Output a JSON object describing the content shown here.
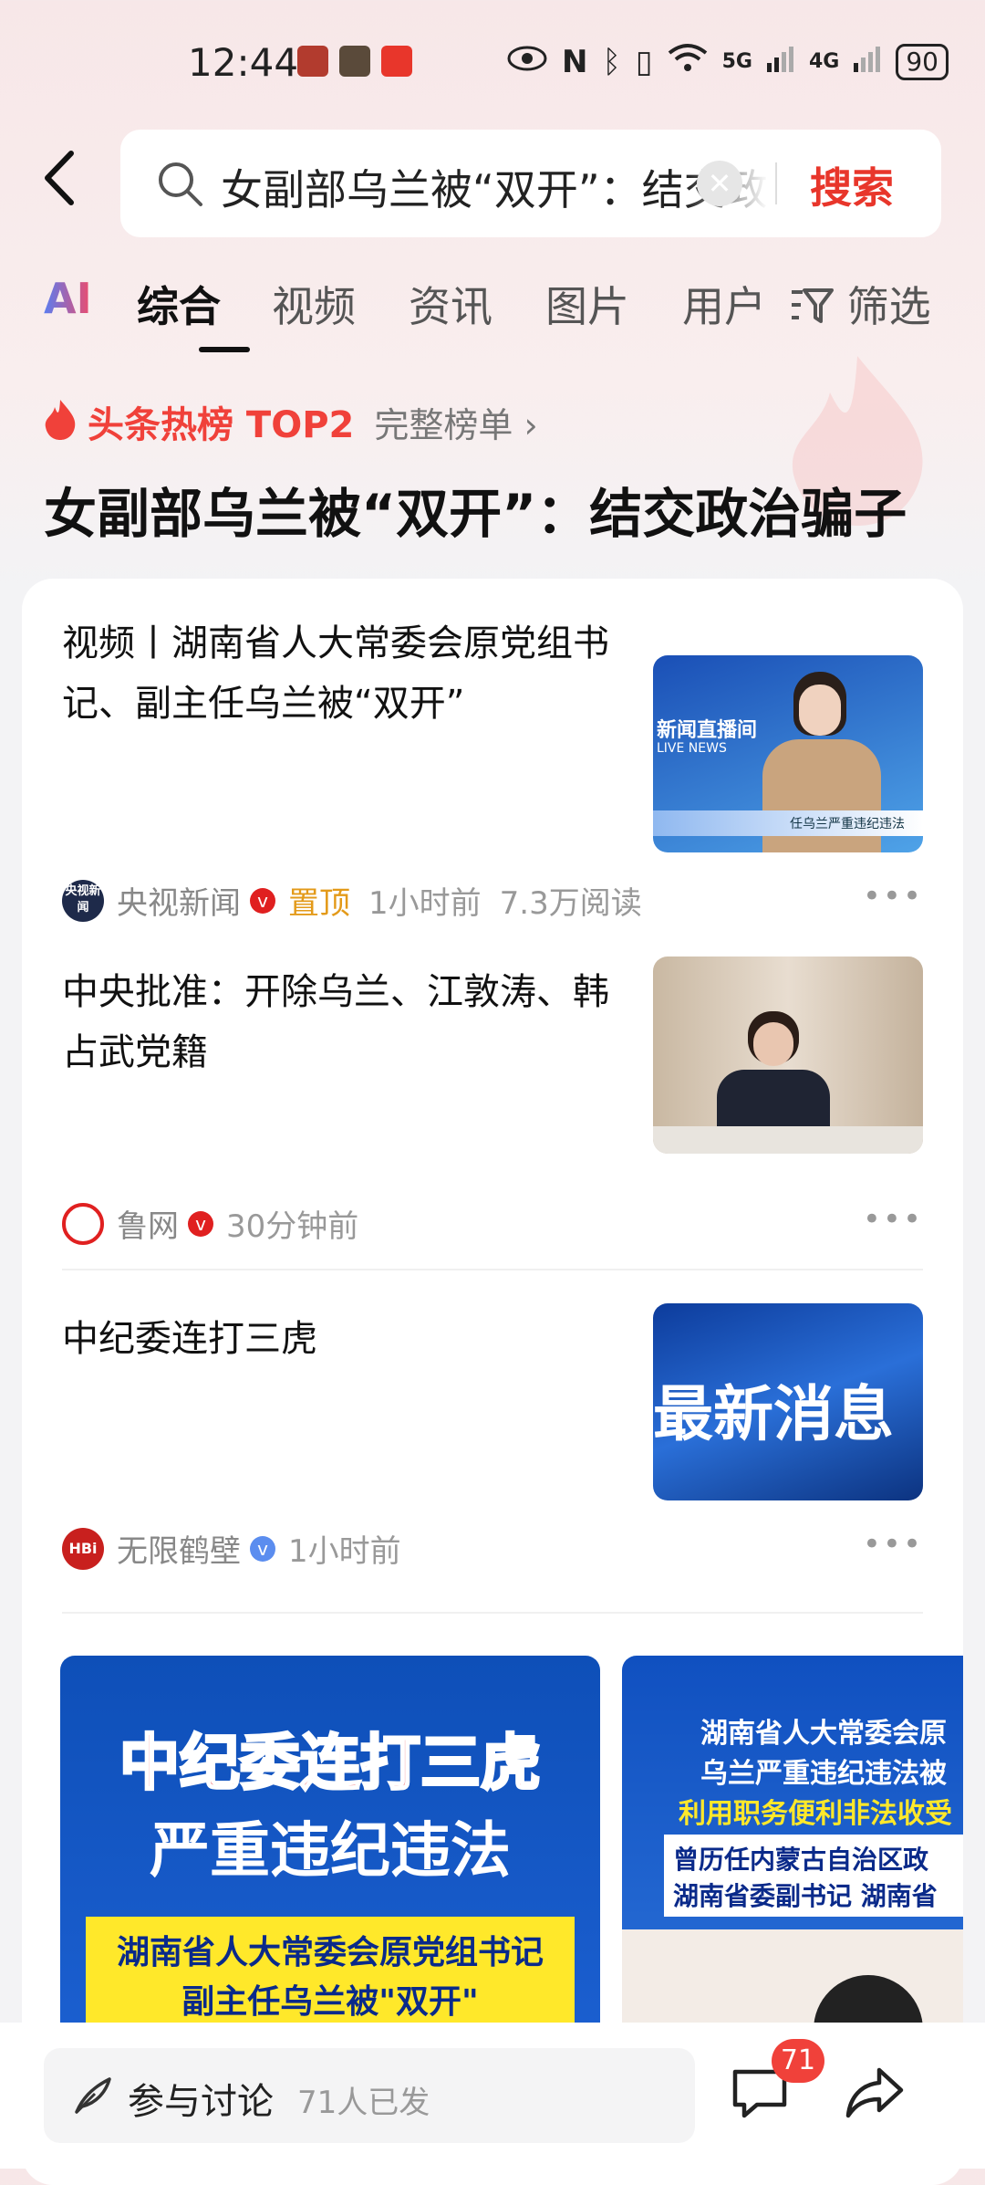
{
  "status_bar": {
    "time": "12:44",
    "battery": "90",
    "network_5g": "5G",
    "network_4g": "4G"
  },
  "search": {
    "query": "女副部乌兰被“双开”：结交政治骗子",
    "button": "搜索"
  },
  "tabs": [
    {
      "label": "AI"
    },
    {
      "label": "综合"
    },
    {
      "label": "视频"
    },
    {
      "label": "资讯"
    },
    {
      "label": "图片"
    },
    {
      "label": "用户"
    },
    {
      "label": "筛选"
    }
  ],
  "hot": {
    "label": "头条热榜 TOP2",
    "full_list": "完整榜单 ›",
    "title": "女副部乌兰被“双开”：结交政治骗子"
  },
  "articles": [
    {
      "title": "视频丨湖南省人大常委会原党组书记、副主任乌兰被“双开”",
      "source": "央视新闻",
      "source_logo": "央视新闻",
      "pinned": "置顶",
      "time": "1小时前",
      "reads": "7.3万阅读",
      "thumb_text": "新闻直播间",
      "thumb_sub": "LIVE NEWS",
      "thumb_caption": "任乌兰严重违纪违法"
    },
    {
      "title": "中央批准：开除乌兰、江敦涛、韩占武党籍",
      "source": "鲁网",
      "time": "30分钟前"
    },
    {
      "title": "中纪委连打三虎",
      "source": "无限鹤壁",
      "source_logo": "HBi",
      "time": "1小时前",
      "thumb_text": "最新消息"
    }
  ],
  "video_cards": [
    {
      "line1": "中纪委连打三虎",
      "line2": "严重违纪违法",
      "line3": "湖南省人大常委会原党组书记",
      "line4": "副主任乌兰被\"双开\""
    },
    {
      "line1": "湖南省人大常委会原",
      "line2": "乌兰严重违纪违法被",
      "line3": "利用职务便利非法收受",
      "line4": "曾历任内蒙古自治区政",
      "line5": "湖南省委副书记 湖南省"
    }
  ],
  "bottom": {
    "discuss_label": "参与讨论",
    "discuss_count": "71人已发",
    "comment_badge": "71"
  },
  "colors": {
    "accent": "#e8362b",
    "hot": "#f0413a",
    "pinned": "#e39a19",
    "verified_red": "#e02020",
    "verified_blue": "#5b8def"
  }
}
